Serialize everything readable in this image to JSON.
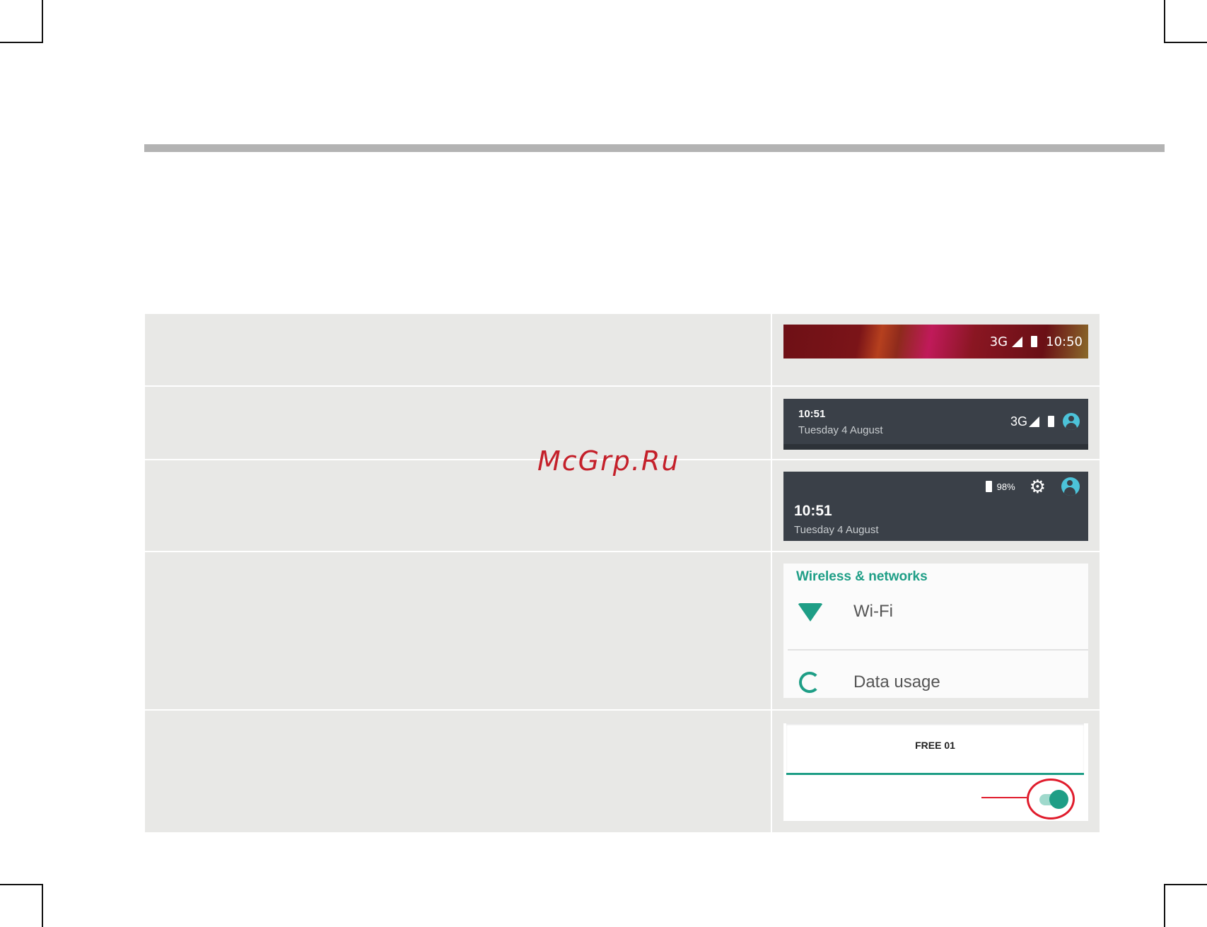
{
  "watermark": "McGrp.Ru",
  "rows": [
    {
      "status_bar": {
        "network": "3G",
        "time": "10:50"
      }
    },
    {
      "notification_header": {
        "time": "10:51",
        "date": "Tuesday 4 August",
        "network": "3G"
      }
    },
    {
      "expanded_header": {
        "battery": "98%",
        "time": "10:51",
        "date": "Tuesday 4 August"
      }
    },
    {
      "settings": {
        "section_title": "Wireless & networks",
        "wifi_label": "Wi-Fi",
        "data_usage_label": "Data usage"
      }
    },
    {
      "network": {
        "name": "FREE 01",
        "toggle_on": true
      }
    }
  ],
  "colors": {
    "accent": "#1e9e86",
    "callout": "#e01c2c",
    "panel": "#3a4048"
  }
}
